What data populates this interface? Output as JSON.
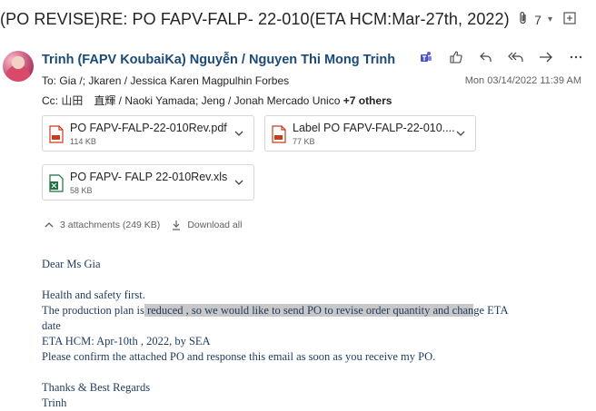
{
  "subject": {
    "text": "(PO REVISE)RE: PO FAPV-FALP- 22-010(ETA HCM:Mar-27th, 2022)",
    "attachment_count": "7"
  },
  "message": {
    "sender": "Trinh (FAPV KoubaiKa) Nguyễn / Nguyen Thi Mong Trinh",
    "to_label": "To:",
    "to": "Gia /;  Jkaren / Jessica Karen Magpulhin Forbes",
    "cc_label": "Cc:",
    "cc": "山田　直輝 / Naoki Yamada;  Jeng / Jonah Mercado Unico",
    "cc_more": "+7 others",
    "date": "Mon 03/14/2022 11:39 AM"
  },
  "attachments": [
    {
      "name": "PO FAPV-FALP-22-010Rev.pdf",
      "size": "114 KB",
      "type": "pdf"
    },
    {
      "name": "Label PO FAPV-FALP-22-010....",
      "size": "77 KB",
      "type": "pdf"
    },
    {
      "name": "PO FAPV- FALP 22-010Rev.xls",
      "size": "58 KB",
      "type": "xls"
    }
  ],
  "attachment_summary": {
    "count_text": "3 attachments (249 KB)",
    "download_all": "Download all"
  },
  "body": {
    "greeting": "Dear Ms Gia",
    "line1": "Health and safety first.",
    "line2_a": "The production plan is",
    "line2_hl": " reduced , so we would like to send  PO to revise order quantity and chan",
    "line2_b": "ge ETA",
    "line3": "date",
    "line4": "ETA HCM: Apr-10th , 2022, by SEA",
    "line5": "Please confirm the attached PO and response this email as soon as you receive my PO.",
    "closing": "Thanks & Best Regards",
    "signature": "Trinh"
  },
  "colors": {
    "sender": "#1b4a78",
    "body_text": "#1f3a5f",
    "highlight": "#c8c8c8",
    "pdf_red": "#c43e1c",
    "excel_green": "#1d6f42"
  }
}
